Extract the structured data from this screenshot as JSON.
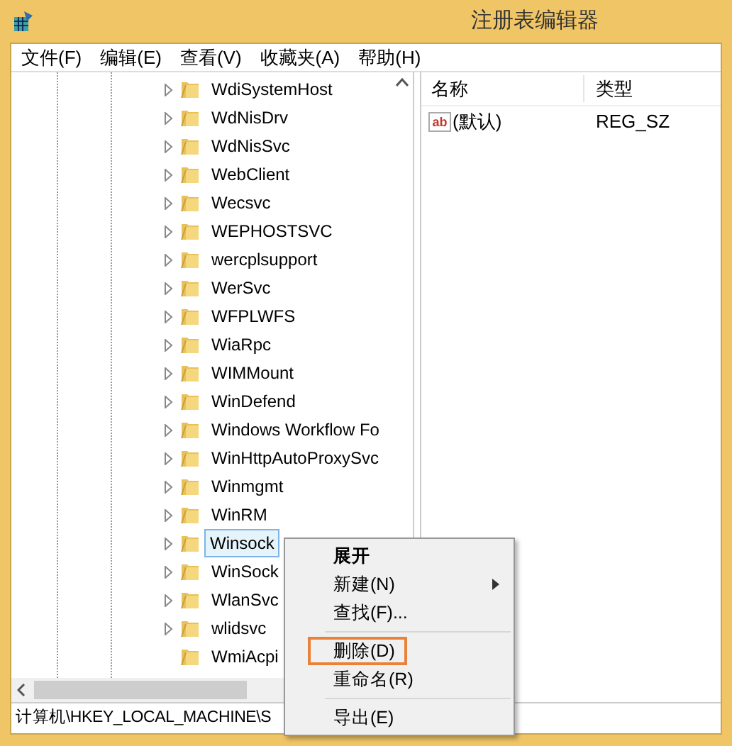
{
  "window": {
    "title": "注册表编辑器"
  },
  "menu_bar": [
    "文件(F)",
    "编辑(E)",
    "查看(V)",
    "收藏夹(A)",
    "帮助(H)"
  ],
  "tree": {
    "items": [
      {
        "label": "WdiSystemHost",
        "expandable": true,
        "selected": false
      },
      {
        "label": "WdNisDrv",
        "expandable": true,
        "selected": false
      },
      {
        "label": "WdNisSvc",
        "expandable": true,
        "selected": false
      },
      {
        "label": "WebClient",
        "expandable": true,
        "selected": false
      },
      {
        "label": "Wecsvc",
        "expandable": true,
        "selected": false
      },
      {
        "label": "WEPHOSTSVC",
        "expandable": true,
        "selected": false
      },
      {
        "label": "wercplsupport",
        "expandable": true,
        "selected": false
      },
      {
        "label": "WerSvc",
        "expandable": true,
        "selected": false
      },
      {
        "label": "WFPLWFS",
        "expandable": true,
        "selected": false
      },
      {
        "label": "WiaRpc",
        "expandable": true,
        "selected": false
      },
      {
        "label": "WIMMount",
        "expandable": true,
        "selected": false
      },
      {
        "label": "WinDefend",
        "expandable": true,
        "selected": false
      },
      {
        "label": "Windows Workflow Fo",
        "expandable": true,
        "selected": false
      },
      {
        "label": "WinHttpAutoProxySvc",
        "expandable": true,
        "selected": false
      },
      {
        "label": "Winmgmt",
        "expandable": true,
        "selected": false
      },
      {
        "label": "WinRM",
        "expandable": true,
        "selected": false
      },
      {
        "label": "Winsock",
        "expandable": true,
        "selected": true
      },
      {
        "label": "WinSock",
        "expandable": true,
        "selected": false
      },
      {
        "label": "WlanSvc",
        "expandable": true,
        "selected": false
      },
      {
        "label": "wlidsvc",
        "expandable": true,
        "selected": false
      },
      {
        "label": "WmiAcpi",
        "expandable": false,
        "selected": false
      }
    ]
  },
  "values_list": {
    "columns": [
      "名称",
      "类型"
    ],
    "rows": [
      {
        "icon_glyph": "ab",
        "name": "(默认)",
        "type": "REG_SZ"
      }
    ]
  },
  "status_bar": "计算机\\HKEY_LOCAL_MACHINE\\S",
  "context_menu": [
    {
      "kind": "item",
      "label": "展开",
      "bold": true,
      "submenu": false,
      "highlighted": false
    },
    {
      "kind": "item",
      "label": "新建(N)",
      "bold": false,
      "submenu": true,
      "highlighted": false
    },
    {
      "kind": "item",
      "label": "查找(F)...",
      "bold": false,
      "submenu": false,
      "highlighted": false
    },
    {
      "kind": "separator"
    },
    {
      "kind": "item",
      "label": "删除(D)",
      "bold": false,
      "submenu": false,
      "highlighted": true
    },
    {
      "kind": "item",
      "label": "重命名(R)",
      "bold": false,
      "submenu": false,
      "highlighted": false
    },
    {
      "kind": "separator"
    },
    {
      "kind": "item",
      "label": "导出(E)",
      "bold": false,
      "submenu": false,
      "highlighted": false
    }
  ]
}
